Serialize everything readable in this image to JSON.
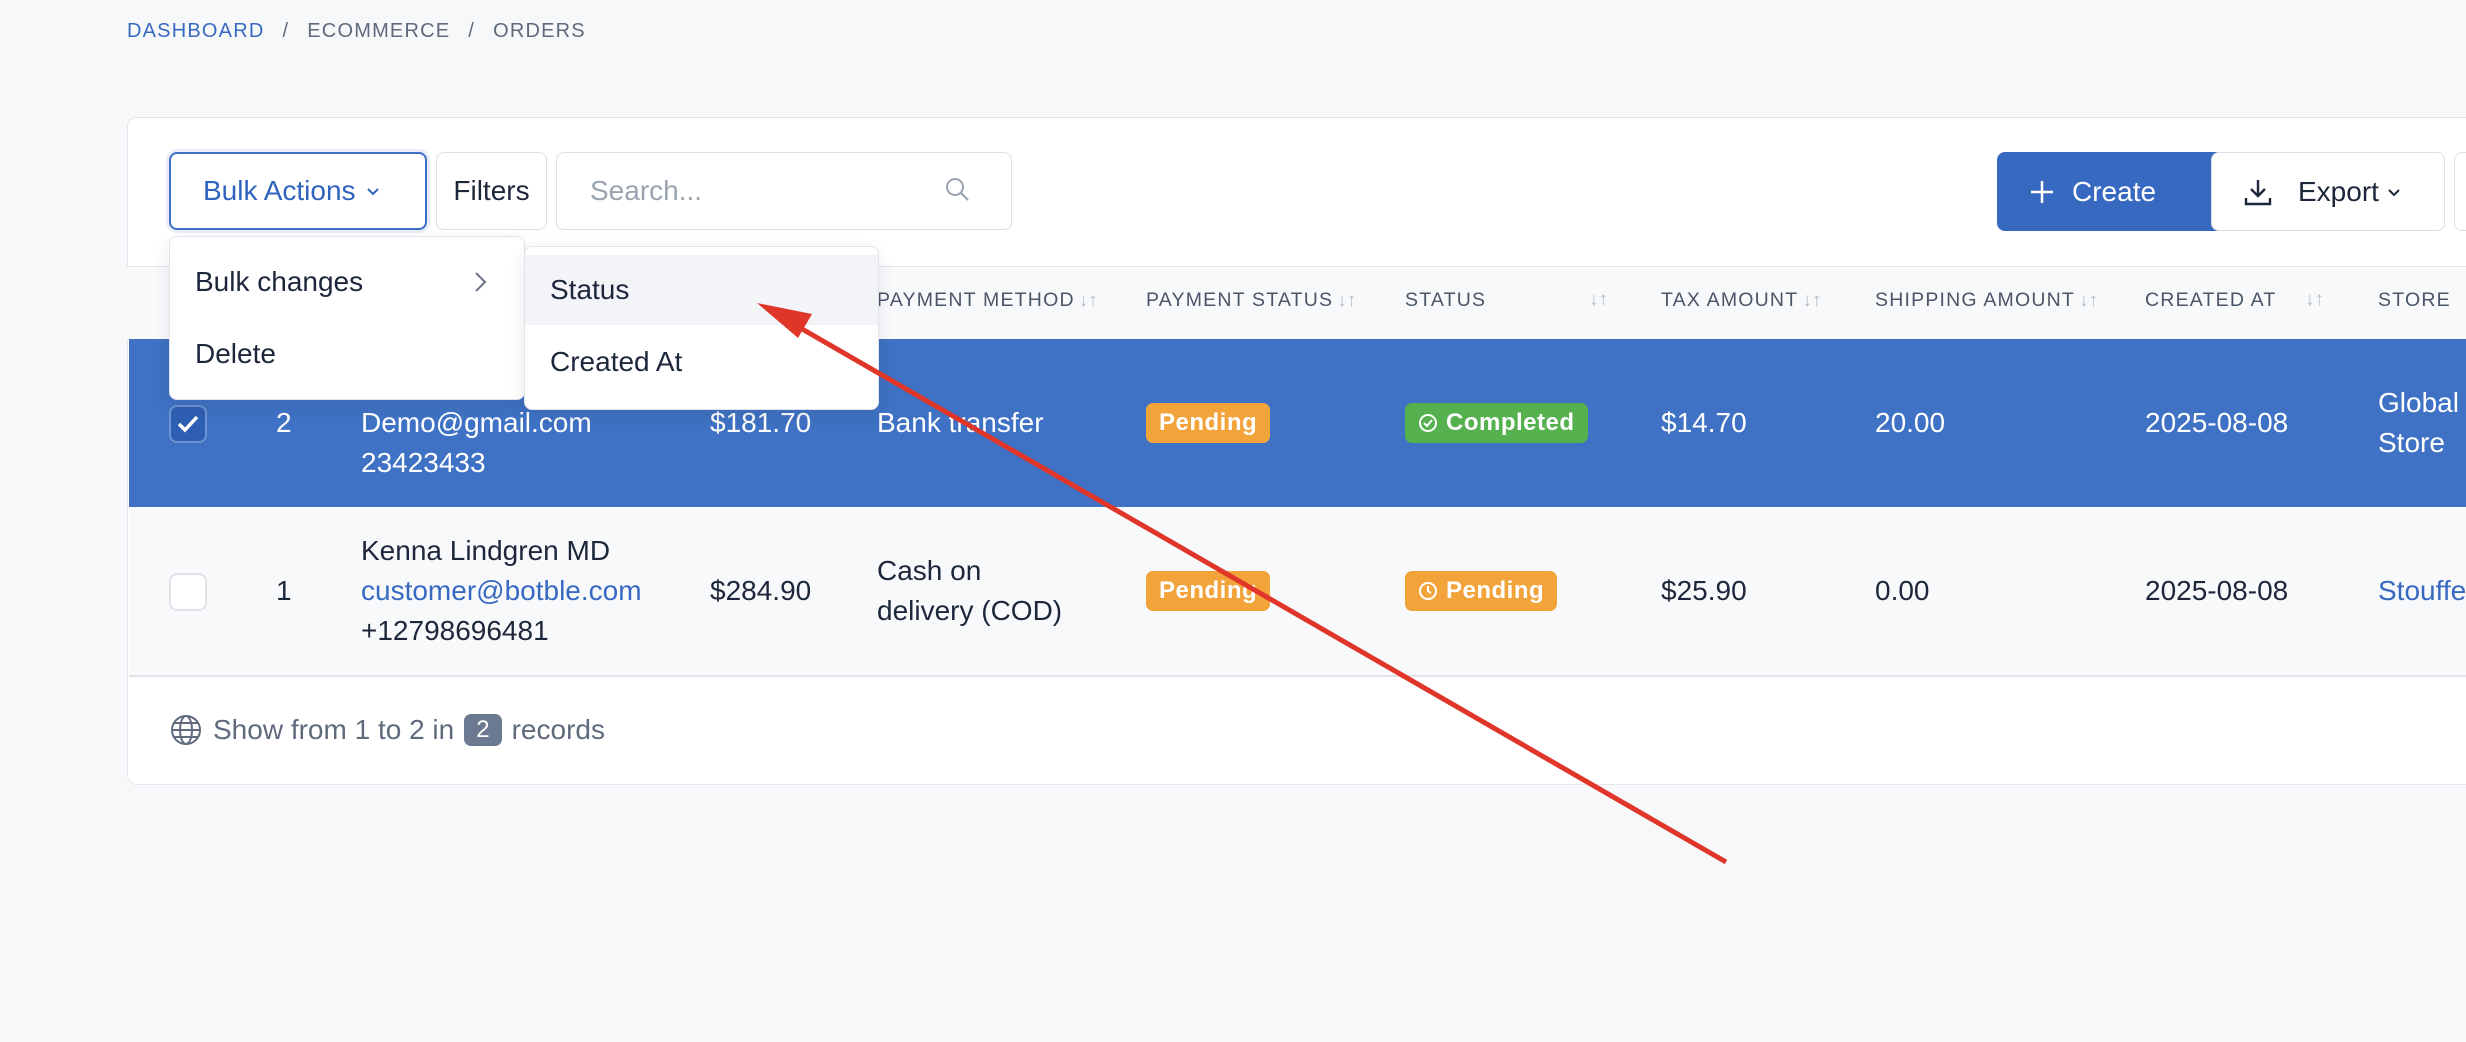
{
  "breadcrumb": {
    "items": [
      "DASHBOARD",
      "ECOMMERCE",
      "ORDERS"
    ],
    "separator": "/"
  },
  "toolbar": {
    "bulk_actions_label": "Bulk Actions",
    "filters_label": "Filters",
    "search_placeholder": "Search...",
    "create_label": "Create",
    "export_label": "Export"
  },
  "bulk_menu": {
    "items": [
      {
        "label": "Bulk changes"
      },
      {
        "label": "Delete"
      }
    ],
    "submenu": [
      {
        "label": "Status"
      },
      {
        "label": "Created At"
      }
    ]
  },
  "table": {
    "columns": [
      "PAYMENT METHOD",
      "PAYMENT STATUS",
      "STATUS",
      "TAX AMOUNT",
      "SHIPPING AMOUNT",
      "CREATED AT",
      "STORE"
    ],
    "rows": [
      {
        "selected": true,
        "id": "2",
        "customer_name": "",
        "email": "Demo@gmail.com",
        "phone": "23423433",
        "amount": "$181.70",
        "payment_method_1": "Bank transfer",
        "payment_method_2": "",
        "payment_status": "Pending",
        "status": "Completed",
        "tax_amount": "$14.70",
        "shipping_amount": "20.00",
        "created_at": "2025-08-08",
        "store_1": "Global",
        "store_2": "Store"
      },
      {
        "selected": false,
        "id": "1",
        "customer_name": "Kenna Lindgren MD",
        "email": "customer@botble.com",
        "phone": "+12798696481",
        "amount": "$284.90",
        "payment_method_1": "Cash on",
        "payment_method_2": "delivery (COD)",
        "payment_status": "Pending",
        "status": "Pending",
        "tax_amount": "$25.90",
        "shipping_amount": "0.00",
        "created_at": "2025-08-08",
        "store_1": "Stouffe",
        "store_2": ""
      }
    ]
  },
  "footer": {
    "prefix": "Show from 1 to 2 in",
    "count": "2",
    "suffix": "records"
  },
  "colors": {
    "primary": "#3869c1",
    "selected_row": "#3f72c4",
    "warning": "#f2a33a",
    "success": "#55b04e",
    "annotation_arrow": "#e0362a"
  }
}
